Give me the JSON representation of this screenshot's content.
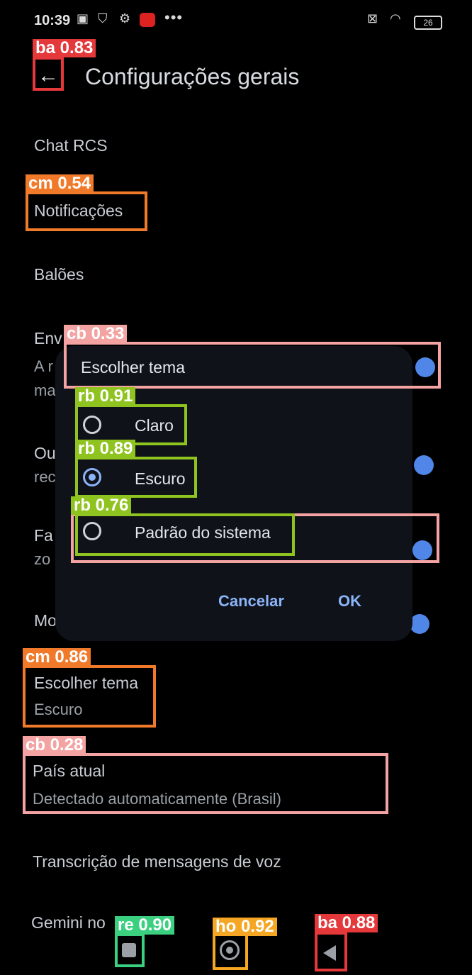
{
  "status_bar": {
    "time": "10:39",
    "dots": "•••",
    "battery": "26"
  },
  "header": {
    "title": "Configurações gerais"
  },
  "settings": {
    "chat_rcs": "Chat RCS",
    "notifications": "Notificações",
    "bubbles": "Balões",
    "partial_env": "Env",
    "partial_a_r": "A r",
    "partial_ma": "ma",
    "partial_ou": "Ou",
    "partial_rec": "rec",
    "partial_fa": "Fa",
    "partial_zo": "zo",
    "partial_mo": "Mo",
    "theme_title": "Escolher tema",
    "theme_value": "Escuro",
    "country_title": "País atual",
    "country_value": "Detectado automaticamente (Brasil)",
    "voice_transcription": "Transcrição de mensagens de voz",
    "gemini_partial": "Gemini no"
  },
  "dialog": {
    "title": "Escolher tema",
    "options": [
      {
        "label": "Claro",
        "selected": false
      },
      {
        "label": "Escuro",
        "selected": true
      },
      {
        "label": "Padrão do sistema",
        "selected": false
      }
    ],
    "cancel": "Cancelar",
    "ok": "OK"
  },
  "detections": [
    {
      "label": "ba 0.83",
      "color": "#e5383b"
    },
    {
      "label": "cm 0.54",
      "color": "#f07a2a"
    },
    {
      "label": "cb 0.33",
      "color": "#f4a3a3"
    },
    {
      "label": "rb 0.91",
      "color": "#8fc31f"
    },
    {
      "label": "rb 0.89",
      "color": "#8fc31f"
    },
    {
      "label": "rb 0.76",
      "color": "#8fc31f"
    },
    {
      "label": "cm 0.86",
      "color": "#f07a2a"
    },
    {
      "label": "cb 0.28",
      "color": "#f4a3a3"
    },
    {
      "label": "re 0.90",
      "color": "#3ad07f"
    },
    {
      "label": "ho 0.92",
      "color": "#f5a623"
    },
    {
      "label": "ba 0.88",
      "color": "#e5383b"
    }
  ],
  "icons": {
    "back": "arrow-left-icon",
    "wifi": "wifi-icon",
    "settings": "gear-icon"
  }
}
